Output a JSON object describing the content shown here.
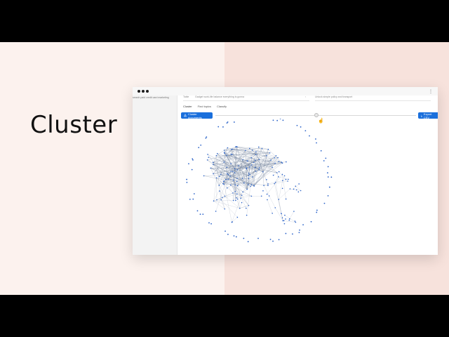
{
  "hero": {
    "title": "Cluster"
  },
  "window": {
    "sidebar_snippet": "search paid credit card marketing",
    "fields": [
      {
        "label": "Table",
        "value": "Gadget work-life balance everything is gonna"
      },
      {
        "value": "Unlock simple policy and transport"
      }
    ],
    "tabs": [
      {
        "label": "Cluster"
      },
      {
        "label": "Find topics"
      },
      {
        "label": "Classify"
      }
    ],
    "buttons": {
      "cluster_label": "Cluster documents",
      "export_label": "Export CSV"
    },
    "slider": {
      "value": 0.5
    }
  },
  "colors": {
    "accent": "#1a6fdc",
    "node": "#2b63c9",
    "edge": "#5d6f8c"
  }
}
